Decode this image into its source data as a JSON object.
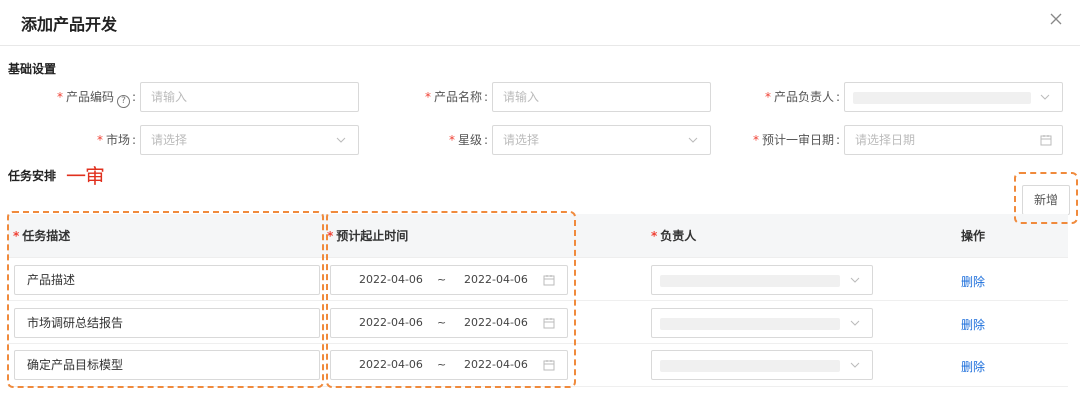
{
  "dialog": {
    "title": "添加产品开发"
  },
  "basic": {
    "section_title": "基础设置",
    "product_code": {
      "label": "产品编码",
      "placeholder": "请输入"
    },
    "product_name": {
      "label": "产品名称",
      "placeholder": "请输入"
    },
    "product_owner": {
      "label": "产品负责人"
    },
    "market": {
      "label": "市场",
      "placeholder": "请选择"
    },
    "star_level": {
      "label": "星级",
      "placeholder": "请选择"
    },
    "review_date": {
      "label": "预计一审日期",
      "placeholder": "请选择日期"
    }
  },
  "tasks": {
    "section_title": "任务安排",
    "stage_annotation": "一审",
    "add_button": "新增",
    "columns": {
      "description": "任务描述",
      "period": "预计起止时间",
      "owner": "负责人",
      "action": "操作"
    },
    "range_separator": "~",
    "rows": [
      {
        "description": "产品描述",
        "start": "2022-04-06",
        "end": "2022-04-06",
        "action": "删除"
      },
      {
        "description": "市场调研总结报告",
        "start": "2022-04-06",
        "end": "2022-04-06",
        "action": "删除"
      },
      {
        "description": "确定产品目标模型",
        "start": "2022-04-06",
        "end": "2022-04-06",
        "action": "删除"
      }
    ]
  },
  "colors": {
    "required": "#f04134",
    "link": "#1a6ddb",
    "highlight": "#f08a3c",
    "annotation": "#e0301e"
  },
  "icons": [
    "close-icon",
    "help-icon",
    "chevron-down-icon",
    "calendar-icon"
  ]
}
